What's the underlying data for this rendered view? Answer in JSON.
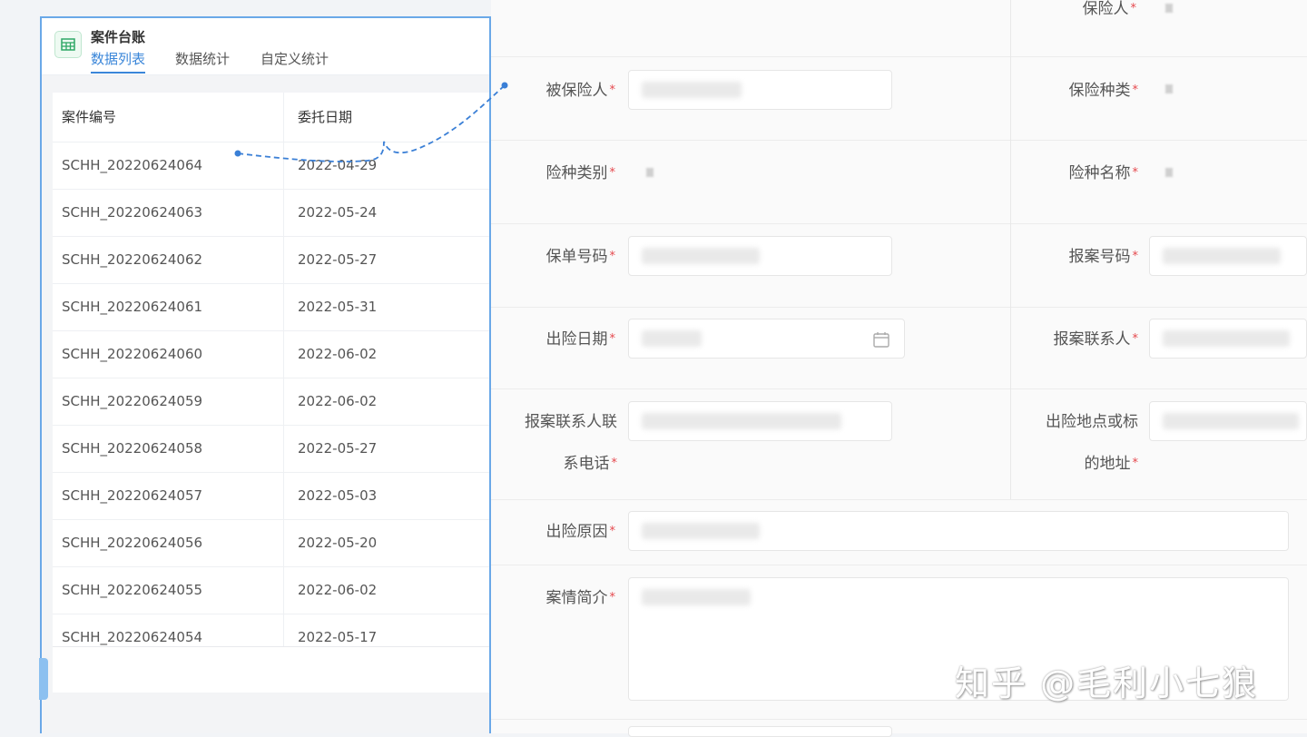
{
  "app": {
    "title": "案件台账",
    "icon": "table-icon",
    "tabs": [
      "数据列表",
      "数据统计",
      "自定义统计"
    ],
    "active_tab": 0
  },
  "table": {
    "columns": [
      "案件编号",
      "委托日期"
    ],
    "rows": [
      {
        "case_no": "SCHH_20220624064",
        "date": "2022-04-29"
      },
      {
        "case_no": "SCHH_20220624063",
        "date": "2022-05-24"
      },
      {
        "case_no": "SCHH_20220624062",
        "date": "2022-05-27"
      },
      {
        "case_no": "SCHH_20220624061",
        "date": "2022-05-31"
      },
      {
        "case_no": "SCHH_20220624060",
        "date": "2022-06-02"
      },
      {
        "case_no": "SCHH_20220624059",
        "date": "2022-06-02"
      },
      {
        "case_no": "SCHH_20220624058",
        "date": "2022-05-27"
      },
      {
        "case_no": "SCHH_20220624057",
        "date": "2022-05-03"
      },
      {
        "case_no": "SCHH_20220624056",
        "date": "2022-05-20"
      },
      {
        "case_no": "SCHH_20220624055",
        "date": "2022-06-02"
      },
      {
        "case_no": "SCHH_20220624054",
        "date": "2022-05-17"
      }
    ]
  },
  "form": {
    "required_mark": "*",
    "fields": {
      "policyholder": "保险人",
      "insured": "被保险人",
      "insurance_type": "保险种类",
      "insurance_category": "险种类别",
      "insurance_name": "险种名称",
      "policy_no": "保单号码",
      "report_no": "报案号码",
      "accident_date": "出险日期",
      "reporter": "报案联系人",
      "reporter_phone_1": "报案联系人联",
      "reporter_phone_2": "系电话",
      "accident_place_1": "出险地点或标",
      "accident_place_2": "的地址",
      "accident_cause": "出险原因",
      "case_summary": "案情简介"
    }
  },
  "watermark": "知乎 @毛利小七狼",
  "colors": {
    "accent": "#3a86d9",
    "panel_border": "#6aa8e8",
    "required": "#e5484d",
    "connector": "#3a7fd6"
  }
}
